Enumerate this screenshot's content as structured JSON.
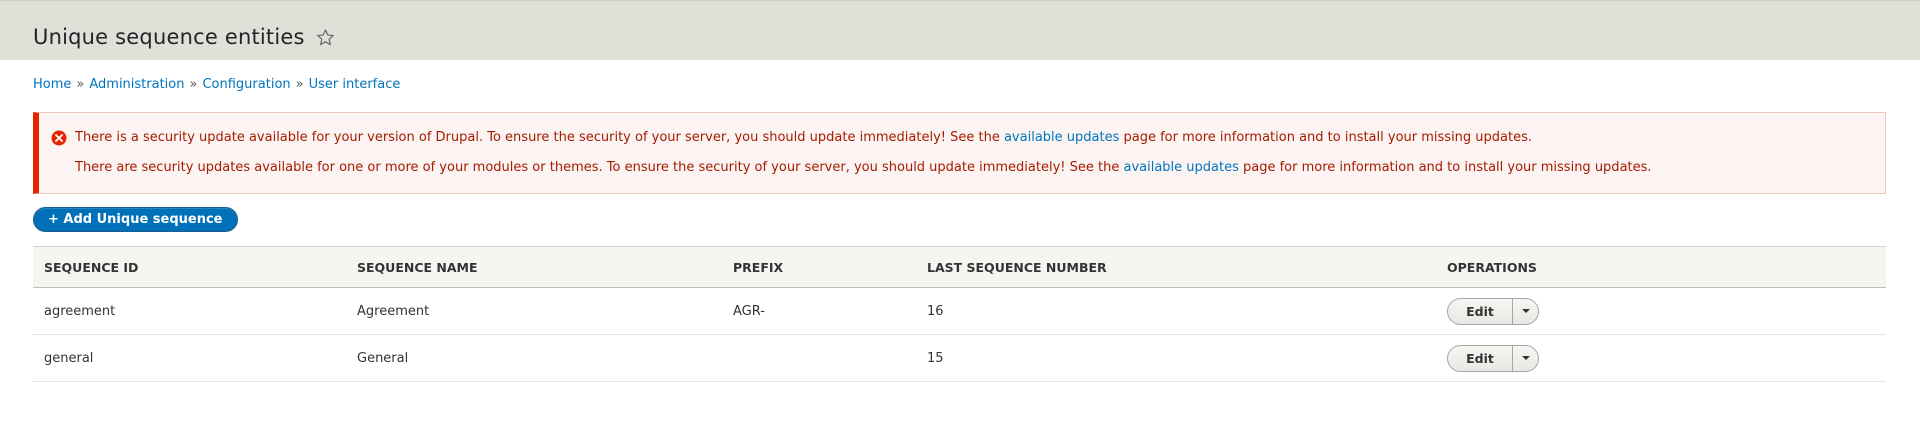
{
  "header": {
    "title": "Unique sequence entities",
    "star_icon": "star-outline-icon"
  },
  "breadcrumb": {
    "items": [
      "Home",
      "Administration",
      "Configuration",
      "User interface"
    ],
    "separator": "»"
  },
  "messages": {
    "icon": "error-circle-icon",
    "line1_before": "There is a security update available for your version of Drupal. To ensure the security of your server, you should update immediately! See the ",
    "line1_link": "available updates",
    "line1_after": " page for more information and to install your missing updates.",
    "line2_before": "There are security updates available for one or more of your modules or themes. To ensure the security of your server, you should update immediately! See the ",
    "line2_link": "available updates",
    "line2_after": " page for more information and to install your missing updates."
  },
  "actions": {
    "add_label": "+ Add Unique sequence"
  },
  "table": {
    "headers": [
      "SEQUENCE ID",
      "SEQUENCE NAME",
      "PREFIX",
      "LAST SEQUENCE NUMBER",
      "OPERATIONS"
    ],
    "rows": [
      {
        "id": "agreement",
        "name": "Agreement",
        "prefix": "AGR-",
        "last": "16",
        "op": "Edit"
      },
      {
        "id": "general",
        "name": "General",
        "prefix": "",
        "last": "15",
        "op": "Edit"
      }
    ]
  },
  "colors": {
    "header_bg": "#e0e0d8",
    "link": "#0074bd",
    "error_text": "#a51b00",
    "error_border": "#e62600",
    "primary_button": "#0071b8"
  }
}
